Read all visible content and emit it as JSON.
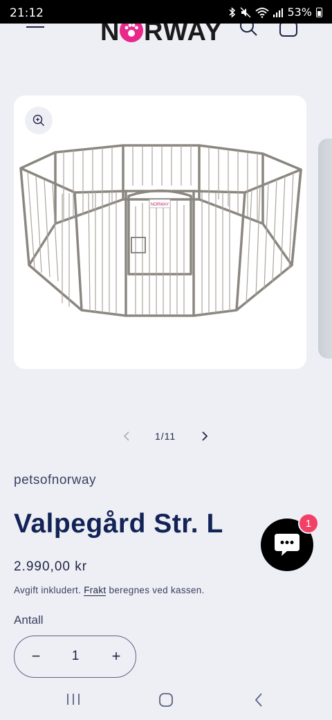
{
  "status_bar": {
    "time": "21:12",
    "battery": "53%",
    "icons": [
      "bluetooth-icon",
      "mute-icon",
      "wifi-icon",
      "signal-icon",
      "battery-icon"
    ]
  },
  "header": {
    "logo_text": "N   RWAY",
    "logo_accent_color": "#e8288a",
    "icons": [
      "menu-icon",
      "search-icon",
      "cart-icon"
    ]
  },
  "gallery": {
    "counter": "1/11",
    "current": 1,
    "total": 11,
    "image_brand_label": "NORWAY"
  },
  "product": {
    "vendor": "petsofnorway",
    "title": "Valpegård Str. L",
    "price": "2.990,00 kr",
    "tax_prefix": "Avgift inkludert.",
    "shipping_link": "Frakt",
    "shipping_suffix": "beregnes ved kassen.",
    "quantity_label": "Antall",
    "quantity_value": "1",
    "minus_symbol": "−",
    "plus_symbol": "+"
  },
  "chat": {
    "badge_count": "1"
  },
  "colors": {
    "background": "#eeeff5",
    "title": "#122356",
    "text": "#1c2444",
    "badge": "#f24166"
  }
}
